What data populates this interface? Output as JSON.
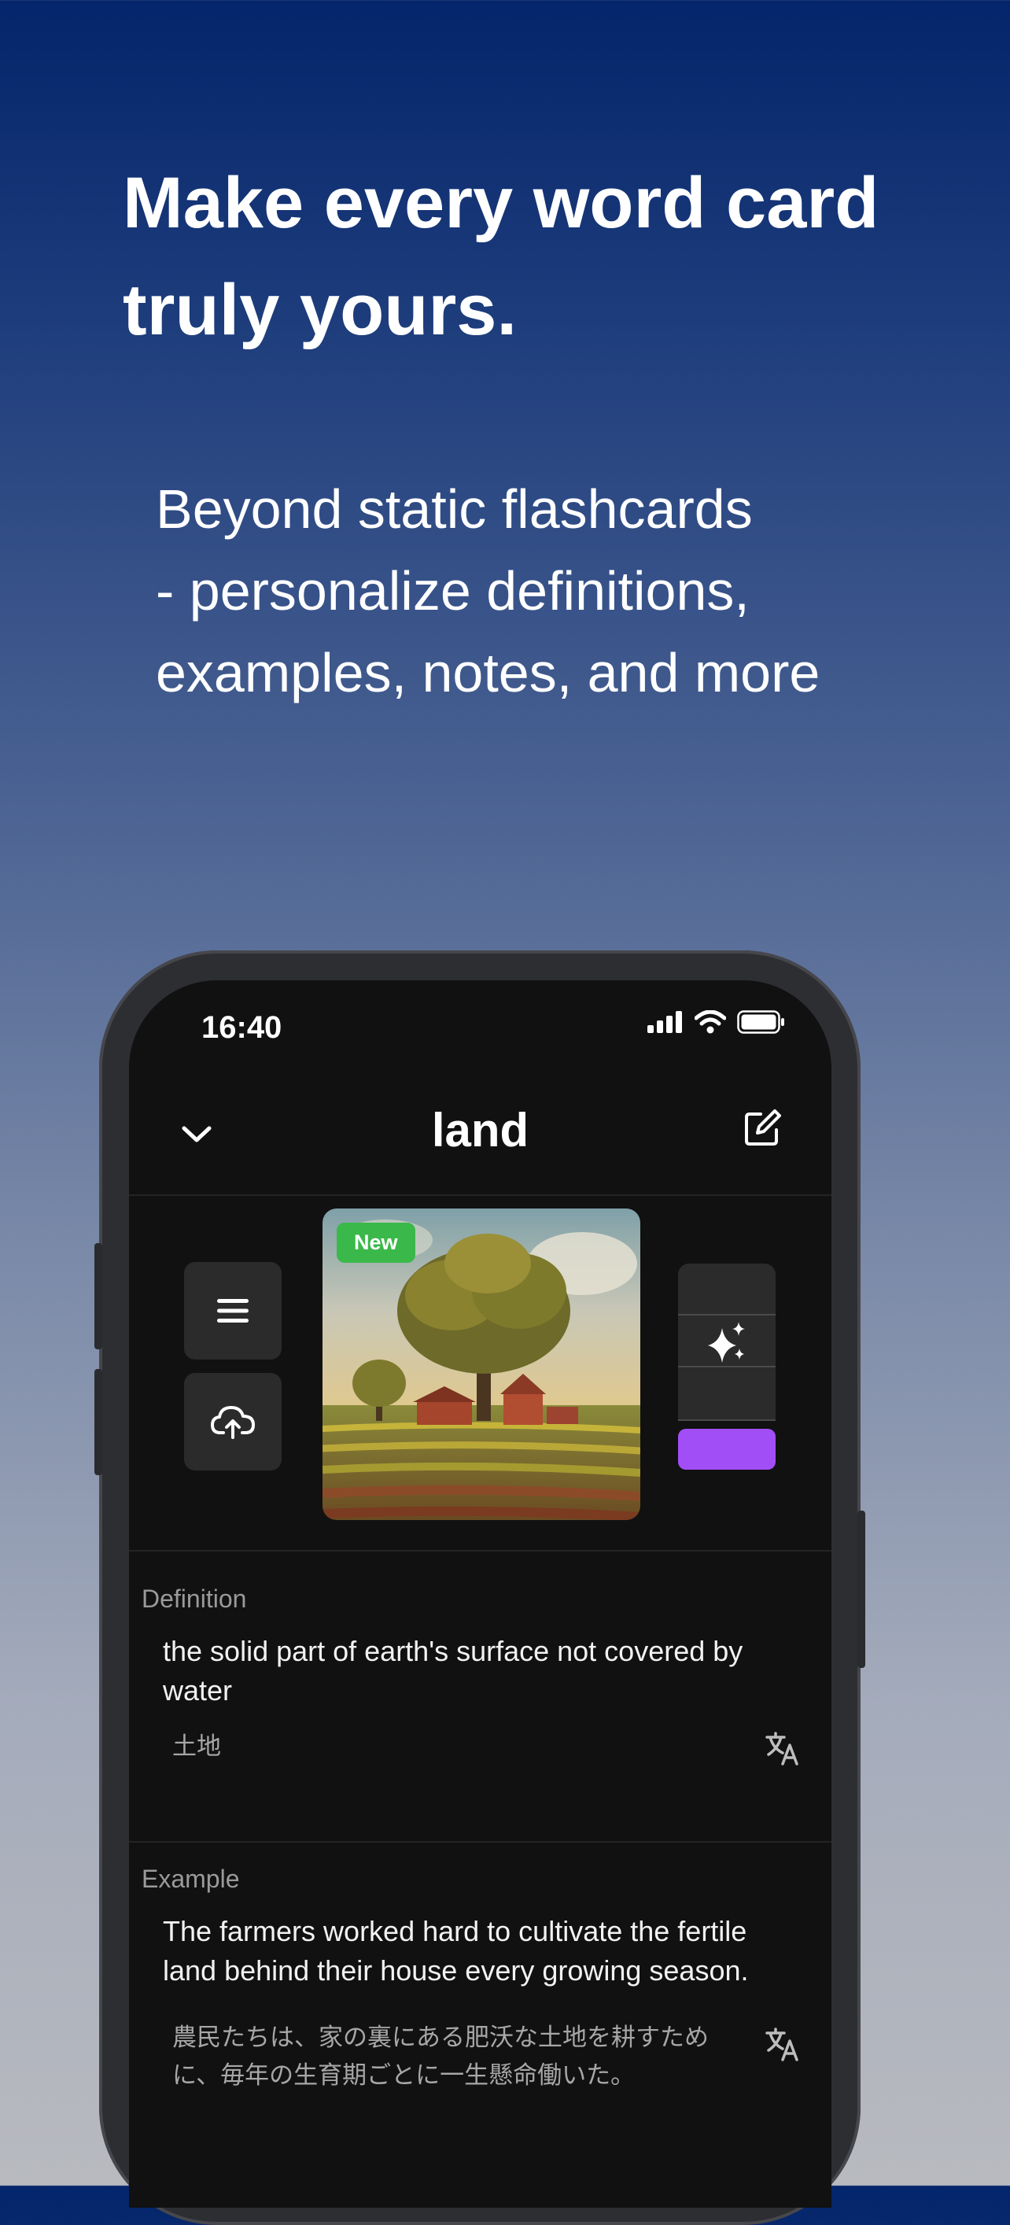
{
  "headline": "Make every word card truly yours.",
  "subhead_lines": [
    "Beyond static flashcards",
    "- personalize definitions,",
    "examples, notes, and more"
  ],
  "phone": {
    "status_time": "16:40",
    "word_title": "land",
    "image_badge": "New",
    "definition": {
      "label": "Definition",
      "text": "the solid part of earth's surface not covered by water",
      "translation": "土地"
    },
    "example": {
      "label": "Example",
      "text": "The farmers worked hard to cultivate the fertile land behind their house every growing season.",
      "translation": "農民たちは、家の裏にある肥沃な土地を耕すために、毎年の生育期ごとに一生懸命働いた。"
    },
    "ai_color": "#a24ef6",
    "icons": [
      "chevron-down-icon",
      "edit-icon",
      "menu-icon",
      "cloud-upload-icon",
      "sparkles-icon",
      "translate-icon"
    ]
  }
}
